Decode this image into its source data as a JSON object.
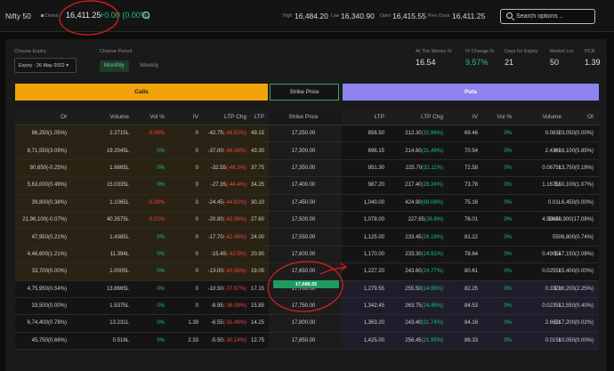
{
  "header": {
    "index_name": "Nifty 50",
    "status": "Closed",
    "price": "16,411.25",
    "change": "+0.00 (0.00%)",
    "high_label": "High",
    "high": "16,484.20",
    "low_label": "Low",
    "low": "16,340.90",
    "open_label": "Open",
    "open": "16,415.55",
    "prev_close_label": "Prev Close",
    "prev_close": "16,411.25",
    "search_placeholder": "Search options .."
  },
  "controls": {
    "expiry_label": "Choose Expiry",
    "expiry_value": "Expiry : 26 May 2022",
    "period_label": "Choose Period",
    "period_active": "Monthly",
    "period_inactive": "Weekly"
  },
  "stats": [
    {
      "label": "At The Money IV",
      "value": "16.54"
    },
    {
      "label": "IV Change %",
      "value": "9.57%"
    },
    {
      "label": "Days for Expiry",
      "value": "21"
    },
    {
      "label": "Market Lot",
      "value": "50"
    },
    {
      "label": "PCR",
      "value": "1.39"
    }
  ],
  "tabs": {
    "calls": "Calls",
    "strike": "Strike Price",
    "puts": "Puts"
  },
  "columns": [
    "OI",
    "Volume",
    "Vol %",
    "IV",
    "LTP Chg",
    "LTP",
    "Strike Price",
    "LTP",
    "LTP Chg",
    "IV",
    "Vol %",
    "Volume",
    "OI"
  ],
  "ltp_marker": "17,688.55",
  "colors": {
    "calls_bg": "#f0a30a",
    "puts_bg": "#8d83ee",
    "itm_call": "#2a2314",
    "itm_put": "#1f1d2c",
    "green": "#21c073",
    "red": "#ef4444"
  },
  "rows": [
    {
      "c_oi": "86,250(1.05%)",
      "c_vol": "2.2715L",
      "c_volp": "-0.09%",
      "c_iv": "0",
      "c_chg": "-42.75 (-46.52%)",
      "c_ltp": "49.15",
      "strike": "17,250.00",
      "p_ltp": "856.50",
      "p_chg": "212.30 (32.96%)",
      "p_iv": "69.46",
      "p_volp": "0%",
      "p_vol": "0.083L",
      "p_oi": "23,050(0.00%)"
    },
    {
      "c_oi": "8,71,550(3.09%)",
      "c_vol": "19.2045L",
      "c_volp": "0%",
      "c_iv": "0",
      "c_chg": "-37.00 (-46.08%)",
      "c_ltp": "43.30",
      "strike": "17,300.00",
      "p_ltp": "896.15",
      "p_chg": "214.60 (31.49%)",
      "p_iv": "70.54",
      "p_volp": "0%",
      "p_vol": "2.434L",
      "p_oi": "4,16,100(5.85%)"
    },
    {
      "c_oi": "80,650(-0.25%)",
      "c_vol": "1.6665L",
      "c_volp": "0%",
      "c_iv": "0",
      "c_chg": "-32.55 (-46.3%)",
      "c_ltp": "37.75",
      "strike": "17,350.00",
      "p_ltp": "951.30",
      "p_chg": "225.70 (31.11%)",
      "p_iv": "72.58",
      "p_volp": "0%",
      "p_vol": "0.0675L",
      "p_oi": "13,750(0.18%)"
    },
    {
      "c_oi": "5,63,000(0.49%)",
      "c_vol": "15.0335L",
      "c_volp": "0%",
      "c_iv": "0",
      "c_chg": "-27.35 (-44.4%)",
      "c_ltp": "34.25",
      "strike": "17,400.00",
      "p_ltp": "987.20",
      "p_chg": "217.40 (28.24%)",
      "p_iv": "73.78",
      "p_volp": "0%",
      "p_vol": "1.1675L",
      "p_oi": "3,50,100(1.07%)"
    },
    {
      "c_oi": "39,800(0.38%)",
      "c_vol": "1.1065L",
      "c_volp": "-0.09%",
      "c_iv": "0",
      "c_chg": "-24.45 (-44.82%)",
      "c_ltp": "30.10",
      "strike": "17,450.00",
      "p_ltp": "1,040.00",
      "p_chg": "424.90 (69.08%)",
      "p_iv": "75.16",
      "p_volp": "0%",
      "p_vol": "0.01L",
      "p_oi": "6,450(0.00%)"
    },
    {
      "c_oi": "21,96,100(-0.07%)",
      "c_vol": "40.3575L",
      "c_volp": "-0.01%",
      "c_iv": "0",
      "c_chg": "-20.80 (-42.98%)",
      "c_ltp": "27.60",
      "strike": "17,500.00",
      "p_ltp": "1,078.00",
      "p_chg": "227.85 (26.8%)",
      "p_iv": "76.01",
      "p_volp": "0%",
      "p_vol": "4.5945L",
      "p_oi": "13,48,900(17.08%)"
    },
    {
      "c_oi": "47,950(0.21%)",
      "c_vol": "1.4385L",
      "c_volp": "0%",
      "c_iv": "0",
      "c_chg": "-17.70 (-42.45%)",
      "c_ltp": "24.00",
      "strike": "17,550.00",
      "p_ltp": "1,125.00",
      "p_chg": "233.45 (26.18%)",
      "p_iv": "81.22",
      "p_volp": "0%",
      "p_vol": "550",
      "p_oi": "6,800(0.74%)"
    },
    {
      "c_oi": "4,46,600(1.21%)",
      "c_vol": "11.394L",
      "c_volp": "0%",
      "c_iv": "0",
      "c_chg": "-15.45 (-42.5%)",
      "c_ltp": "20.90",
      "strike": "17,600.00",
      "p_ltp": "1,170.00",
      "p_chg": "233.30 (24.91%)",
      "p_iv": "78.64",
      "p_volp": "0%",
      "p_vol": "0.4905L",
      "p_oi": "1,47,150(2.08%)"
    },
    {
      "c_oi": "33,700(0.00%)",
      "c_vol": "1.0005L",
      "c_volp": "0%",
      "c_iv": "0",
      "c_chg": "-13.00 (-40.56%)",
      "c_ltp": "19.05",
      "strike": "17,650.00",
      "p_ltp": "1,227.20",
      "p_chg": "243.60 (24.77%)",
      "p_iv": "80.61",
      "p_volp": "0%",
      "p_vol": "0.0255L",
      "p_oi": "15,400(0.00%)"
    },
    {
      "c_oi": "4,75,950(0.54%)",
      "c_vol": "13.8665L",
      "c_volp": "0%",
      "c_iv": "0",
      "c_chg": "-10.50 (-37.97%)",
      "c_ltp": "17.15",
      "strike": "17,700.00",
      "p_ltp": "1,279.55",
      "p_chg": "255.50 (24.95%)",
      "p_iv": "82.25",
      "p_volp": "0%",
      "p_vol": "0.337L",
      "p_oi": "1,36,200(2.25%)"
    },
    {
      "c_oi": "33,500(0.00%)",
      "c_vol": "1.5375L",
      "c_volp": "0%",
      "c_iv": "0",
      "c_chg": "-8.95 (-36.09%)",
      "c_ltp": "15.85",
      "strike": "17,750.00",
      "p_ltp": "1,342.45",
      "p_chg": "263.75 (24.45%)",
      "p_iv": "84.53",
      "p_volp": "0%",
      "p_vol": "0.0235L",
      "p_oi": "12,550(0.40%)"
    },
    {
      "c_oi": "6,74,400(0.78%)",
      "c_vol": "13.231L",
      "c_volp": "0%",
      "c_iv": "1.39",
      "c_chg": "-6.55 (-31.49%)",
      "c_ltp": "14.25",
      "strike": "17,800.00",
      "p_ltp": "1,363.20",
      "p_chg": "243.40 (21.74%)",
      "p_iv": "84.16",
      "p_volp": "0%",
      "p_vol": "2.663L",
      "p_oi": "2,17,200(0.02%)"
    },
    {
      "c_oi": "45,750(0.66%)",
      "c_vol": "0.516L",
      "c_volp": "0%",
      "c_iv": "2.33",
      "c_chg": "-5.50 (-30.14%)",
      "c_ltp": "12.75",
      "strike": "17,850.00",
      "p_ltp": "1,425.00",
      "p_chg": "256.45 (21.95%)",
      "p_iv": "86.33",
      "p_volp": "0%",
      "p_vol": "0.015L",
      "p_oi": "10,050(0.00%)"
    }
  ]
}
